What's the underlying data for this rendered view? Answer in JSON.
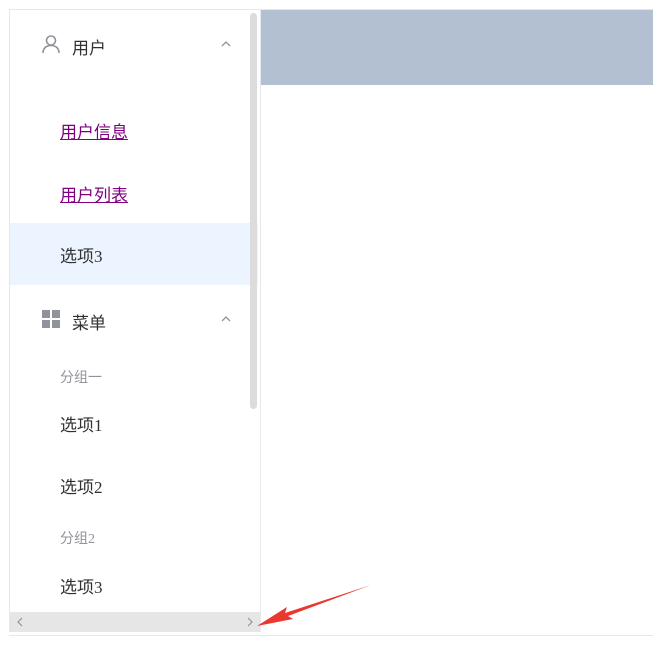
{
  "menu": {
    "user": {
      "label": "用户",
      "icon": "user-icon",
      "items": [
        {
          "label": "用户信息",
          "style": "link"
        },
        {
          "label": "用户列表",
          "style": "link"
        },
        {
          "label": "选项3",
          "style": "active"
        }
      ]
    },
    "menu_group": {
      "label": "菜单",
      "icon": "grid-menu-icon",
      "groups": [
        {
          "title": "分组一",
          "items": [
            {
              "label": "选项1"
            },
            {
              "label": "选项2"
            }
          ]
        },
        {
          "title": "分组2",
          "items": [
            {
              "label": "选项3"
            }
          ]
        }
      ]
    }
  },
  "colors": {
    "header_bg": "#b3c0d1",
    "active_bg": "#ecf5ff",
    "link_visited": "#800080",
    "annotation_arrow": "#e8382f"
  },
  "icons": {
    "scroll_left": "chevron-left-icon",
    "scroll_right": "chevron-right-icon",
    "expand": "chevron-up-icon"
  }
}
